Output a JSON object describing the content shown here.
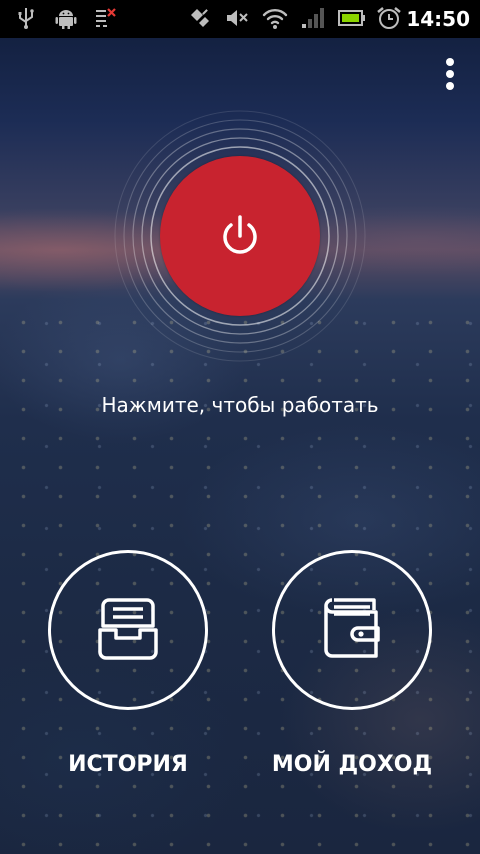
{
  "status_bar": {
    "time": "14:50",
    "icons": [
      "usb-icon",
      "android-debug-icon",
      "notification-list-icon",
      "sync-icon",
      "mute-icon",
      "wifi-icon",
      "signal-icon",
      "battery-icon",
      "alarm-icon"
    ]
  },
  "menu": {
    "icon": "overflow-menu-icon"
  },
  "power": {
    "icon": "power-icon",
    "button_color": "#c8232f",
    "hint": "Нажмите, чтобы работать"
  },
  "nav": {
    "history": {
      "icon": "inbox-tray-icon",
      "label": "ИСТОРИЯ"
    },
    "income": {
      "icon": "wallet-icon",
      "label": "МОЙ ДОХОД"
    }
  }
}
